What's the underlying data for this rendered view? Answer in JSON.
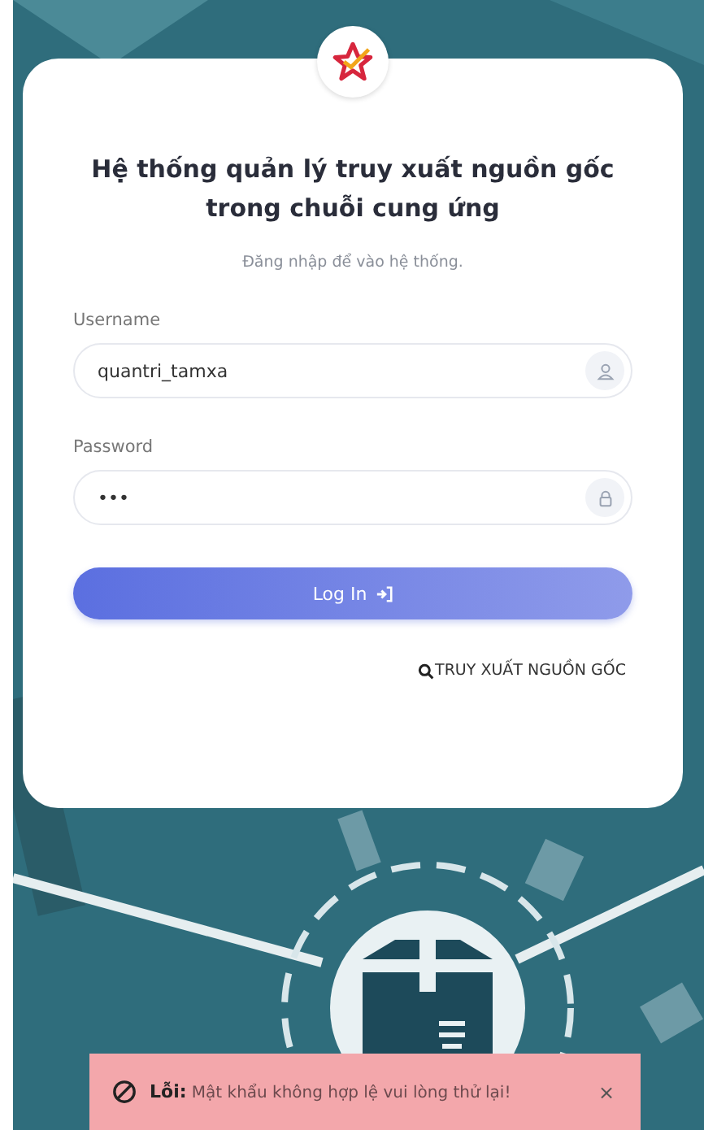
{
  "login": {
    "title": "Hệ thống quản lý truy xuất nguồn gốc trong chuỗi cung ứng",
    "subtitle": "Đăng nhập để vào hệ thống.",
    "fields": [
      {
        "label": "Username",
        "value": "quantri_tamxa",
        "kind": "user"
      },
      {
        "label": "Password",
        "value": "•••",
        "kind": "lock"
      }
    ],
    "submit": "Log In",
    "trace_link": "TRUY XUẤT NGUỒN GỐC"
  },
  "toast": {
    "title": "Lỗi:",
    "message": "Mật khẩu không hợp lệ vui lòng thử lại!",
    "close": "×"
  }
}
